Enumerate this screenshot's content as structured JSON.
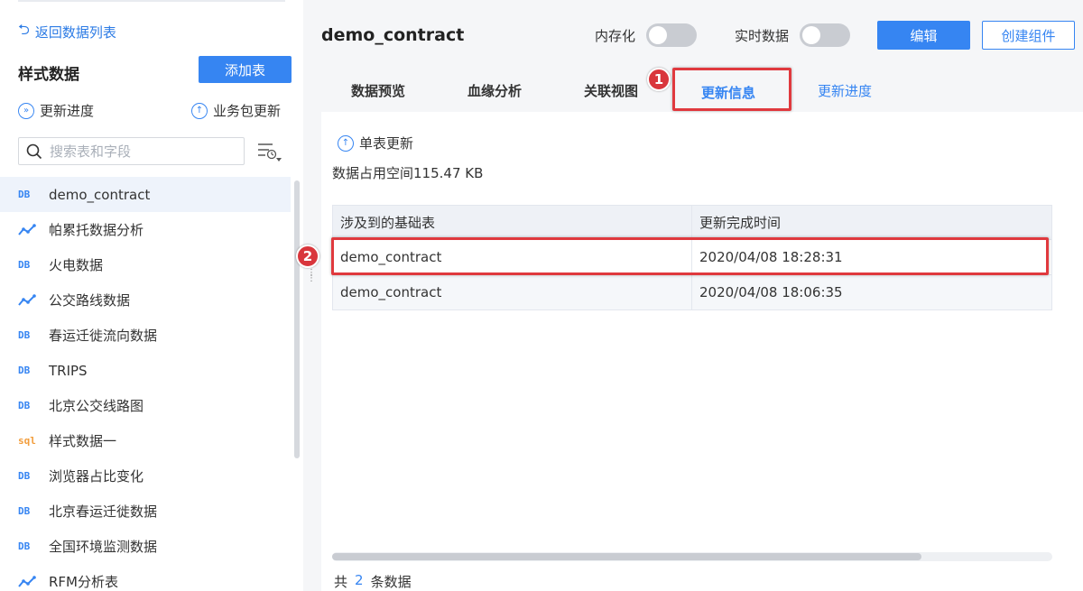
{
  "sidebar": {
    "back_label": "返回数据列表",
    "title": "样式数据",
    "add_table_label": "添加表",
    "update_progress_label": "更新进度",
    "package_update_label": "业务包更新",
    "search_placeholder": "搜索表和字段",
    "items": [
      {
        "icon": "DB",
        "label": "demo_contract"
      },
      {
        "icon": "chart-line-icon",
        "label": "帕累托数据分析"
      },
      {
        "icon": "DB",
        "label": "火电数据"
      },
      {
        "icon": "chart-line-icon",
        "label": "公交路线数据"
      },
      {
        "icon": "DB",
        "label": "春运迁徙流向数据"
      },
      {
        "icon": "DB",
        "label": "TRIPS"
      },
      {
        "icon": "DB",
        "label": "北京公交线路图"
      },
      {
        "icon": "sql",
        "label": "样式数据一"
      },
      {
        "icon": "DB",
        "label": "浏览器占比变化"
      },
      {
        "icon": "DB",
        "label": "北京春运迁徙数据"
      },
      {
        "icon": "DB",
        "label": "全国环境监测数据"
      },
      {
        "icon": "chart-line-icon",
        "label": "RFM分析表"
      }
    ]
  },
  "header": {
    "title": "demo_contract",
    "in_memory_label": "内存化",
    "realtime_label": "实时数据",
    "edit_label": "编辑",
    "create_component_label": "创建组件"
  },
  "tabs": [
    {
      "label": "数据预览"
    },
    {
      "label": "血缘分析"
    },
    {
      "label": "关联视图"
    },
    {
      "label": "更新信息"
    },
    {
      "label": "更新进度"
    }
  ],
  "annotations": {
    "badge1": "1",
    "badge2": "2"
  },
  "content": {
    "single_update_label": "单表更新",
    "space_text": "数据占用空间115.47 KB",
    "table_headers": [
      "涉及到的基础表",
      "更新完成时间"
    ],
    "rows": [
      [
        "demo_contract",
        "2020/04/08 18:28:31"
      ],
      [
        "demo_contract",
        "2020/04/08 18:06:35"
      ]
    ],
    "footer_prefix": "共",
    "footer_count": "2",
    "footer_suffix": "条数据"
  },
  "colors": {
    "accent": "#3685f2",
    "highlight": "#e0393e"
  }
}
